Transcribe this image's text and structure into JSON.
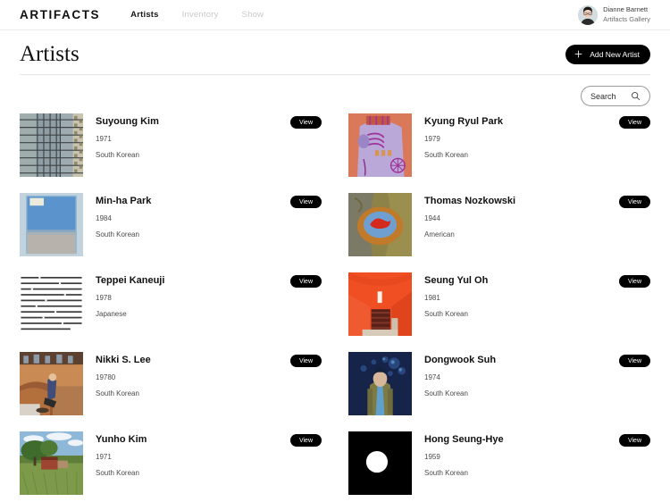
{
  "brand": {
    "logo": "ARTIFACTS"
  },
  "nav": {
    "items": [
      {
        "label": "Artists",
        "active": true
      },
      {
        "label": "Inventory",
        "active": false
      },
      {
        "label": "Show",
        "active": false
      }
    ]
  },
  "user": {
    "name": "Dianne Barnett",
    "organization": "Artifacts Gallery",
    "avatar_icon": "user-avatar-photo"
  },
  "header": {
    "title": "Artists",
    "add_button_label": "Add New Artist",
    "add_button_icon": "plus-icon",
    "add_button_color": "#000000"
  },
  "search": {
    "placeholder": "Search",
    "value": "",
    "icon": "search-icon"
  },
  "artists": [
    {
      "name": "Suyoung Kim",
      "year": "1971",
      "nationality": "South Korean",
      "view_label": "View",
      "thumb": "architectural-grid-facade",
      "colors": [
        "#a9b5b5",
        "#8f9ea4",
        "#6d7a80",
        "#c8c3ae"
      ]
    },
    {
      "name": "Kyung Ryul Park",
      "year": "1979",
      "nationality": "South Korean",
      "view_label": "View",
      "thumb": "lavender-orange-abstract-painting",
      "colors": [
        "#d9795a",
        "#b9a8d8",
        "#a0329b",
        "#c4553f"
      ]
    },
    {
      "name": "Min-ha Park",
      "year": "1984",
      "nationality": "South Korean",
      "view_label": "View",
      "thumb": "blue-sky-gray-field-painting",
      "colors": [
        "#bcd3e6",
        "#5b93cc",
        "#b7b2ab",
        "#e8eef2"
      ]
    },
    {
      "name": "Thomas Nozkowski",
      "year": "1944",
      "nationality": "American",
      "view_label": "View",
      "thumb": "olive-abstract-oval-painting",
      "colors": [
        "#8d8247",
        "#c07a2a",
        "#6f9fd0",
        "#d42a1e"
      ]
    },
    {
      "name": "Teppei Kaneuji",
      "year": "1978",
      "nationality": "Japanese",
      "view_label": "View",
      "thumb": "printed-article-text-page",
      "colors": [
        "#ffffff",
        "#3a3a3a"
      ]
    },
    {
      "name": "Seung Yul Oh",
      "year": "1981",
      "nationality": "South Korean",
      "view_label": "View",
      "thumb": "orange-stairwell-interior",
      "colors": [
        "#f04e23",
        "#e8491f",
        "#5a2118",
        "#cdbfae"
      ]
    },
    {
      "name": "Nikki S. Lee",
      "year": "19780",
      "nationality": "South Korean",
      "view_label": "View",
      "thumb": "skatepark-photograph",
      "colors": [
        "#9a5a33",
        "#c98a53",
        "#3f4d78",
        "#d8d2c8"
      ]
    },
    {
      "name": "Dongwook Suh",
      "year": "1974",
      "nationality": "South Korean",
      "view_label": "View",
      "thumb": "night-portrait-blue-painting",
      "colors": [
        "#16244a",
        "#2c4c86",
        "#7d7a45",
        "#5fa0cd"
      ]
    },
    {
      "name": "Yunho Kim",
      "year": "1971",
      "nationality": "South Korean",
      "view_label": "View",
      "thumb": "green-field-red-building-photo",
      "colors": [
        "#8fb7d8",
        "#4e7a34",
        "#7c9a4a",
        "#9d4530"
      ]
    },
    {
      "name": "Hong Seung-Hye",
      "year": "1959",
      "nationality": "South Korean",
      "view_label": "View",
      "thumb": "black-square-white-circle",
      "colors": [
        "#000000",
        "#ffffff"
      ]
    }
  ]
}
